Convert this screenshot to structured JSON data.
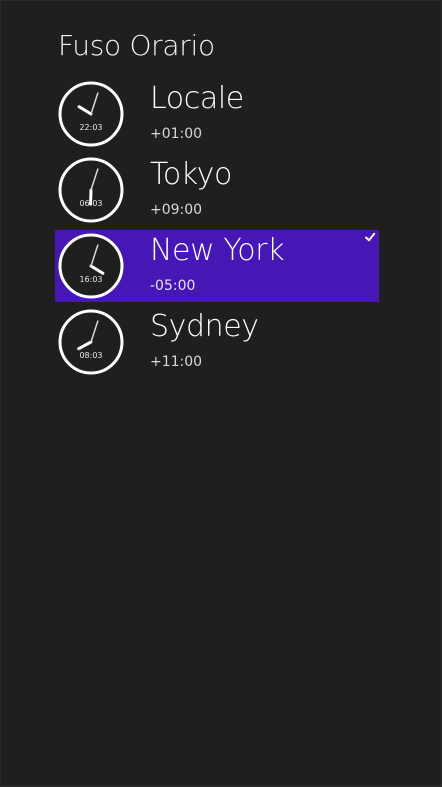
{
  "page": {
    "title": "Fuso Orario"
  },
  "zones": [
    {
      "name": "Locale",
      "offset": "+01:00",
      "clock_time": "22:03",
      "hour": 22,
      "minute": 3,
      "selected": false
    },
    {
      "name": "Tokyo",
      "offset": "+09:00",
      "clock_time": "06:03",
      "hour": 6,
      "minute": 3,
      "selected": false
    },
    {
      "name": "New York",
      "offset": "-05:00",
      "clock_time": "16:03",
      "hour": 16,
      "minute": 3,
      "selected": true
    },
    {
      "name": "Sydney",
      "offset": "+11:00",
      "clock_time": "08:03",
      "hour": 8,
      "minute": 3,
      "selected": false
    }
  ],
  "icons": {
    "clock": "analog-clock-icon",
    "selected": "check-icon"
  },
  "colors": {
    "background": "#1f1f1f",
    "selection": "#4617b4",
    "text": "#ffffff"
  }
}
